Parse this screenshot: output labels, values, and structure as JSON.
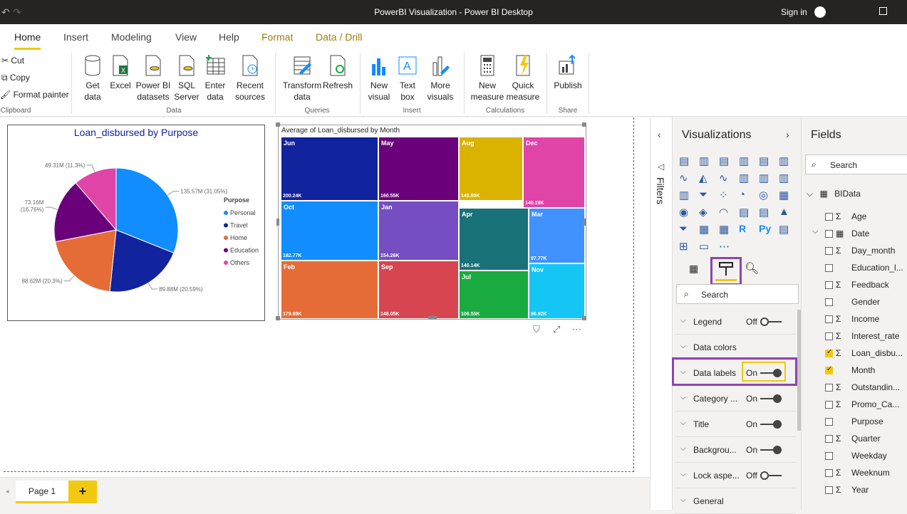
{
  "window": {
    "title": "PowerBI Visualization - Power BI Desktop",
    "signin": "Sign in"
  },
  "tabs": [
    "Home",
    "Insert",
    "Modeling",
    "View",
    "Help",
    "Format",
    "Data / Drill"
  ],
  "ribbon": {
    "clipboard": {
      "cut": "Cut",
      "copy": "Copy",
      "format_painter": "Format painter",
      "group": "Clipboard"
    },
    "data": {
      "get_data": "Get\ndata",
      "excel": "Excel",
      "pbi_datasets": "Power BI\ndatasets",
      "sql": "SQL\nServer",
      "enter": "Enter\ndata",
      "recent": "Recent\nsources",
      "group": "Data"
    },
    "queries": {
      "transform": "Transform\ndata",
      "refresh": "Refresh",
      "group": "Queries"
    },
    "insert": {
      "new_visual": "New\nvisual",
      "text_box": "Text\nbox",
      "more_visuals": "More\nvisuals",
      "group": "Insert"
    },
    "calculations": {
      "new_measure": "New\nmeasure",
      "quick_measure": "Quick\nmeasure",
      "group": "Calculations"
    },
    "share": {
      "publish": "Publish",
      "group": "Share"
    }
  },
  "pie_chart": {
    "title": "Loan_disbursed by Purpose",
    "legend_title": "Purpose",
    "slices": [
      {
        "name": "Personal",
        "label": "135.57M (31.05%)",
        "share": 0.3105,
        "color": "#118DFF"
      },
      {
        "name": "Travel",
        "label": "89.88M (20.59%)",
        "share": 0.2059,
        "color": "#12239E"
      },
      {
        "name": "Home",
        "label": "88.62M (20.3%)",
        "share": 0.203,
        "color": "#E66C37"
      },
      {
        "name": "Education",
        "label": "73.16M (16.76%)",
        "share": 0.1676,
        "color": "#6B007B"
      },
      {
        "name": "Others",
        "label": "49.31M (11.3%)",
        "share": 0.113,
        "color": "#E044A7"
      }
    ]
  },
  "treemap": {
    "title": "Average of Loan_disbursed by Month",
    "tiles": [
      {
        "name": "Jun",
        "value": "200.24K",
        "color": "#12239E"
      },
      {
        "name": "May",
        "value": "160.55K",
        "color": "#6B007B"
      },
      {
        "name": "Aug",
        "value": "145.80K",
        "color": "#D9B300"
      },
      {
        "name": "Dec",
        "value": "140.19K",
        "color": "#E044A7"
      },
      {
        "name": "Oct",
        "value": "182.77K",
        "color": "#118DFF"
      },
      {
        "name": "Jan",
        "value": "154.26K",
        "color": "#744EC2"
      },
      {
        "name": "Apr",
        "value": "140.14K",
        "color": "#197278"
      },
      {
        "name": "Mar",
        "value": "97.77K",
        "color": "#4092FF"
      },
      {
        "name": "Feb",
        "value": "179.89K",
        "color": "#E66C37"
      },
      {
        "name": "Sep",
        "value": "148.05K",
        "color": "#D64550"
      },
      {
        "name": "Jul",
        "value": "106.55K",
        "color": "#1AAB40"
      },
      {
        "name": "Nov",
        "value": "96.92K",
        "color": "#15C6F4"
      }
    ]
  },
  "filters_label": "Filters",
  "visualizations": {
    "title": "Visualizations",
    "search_placeholder": "Search",
    "format_rows": [
      {
        "label": "Legend",
        "state": "Off"
      },
      {
        "label": "Data colors",
        "state": ""
      },
      {
        "label": "Data labels",
        "state": "On"
      },
      {
        "label": "Category ...",
        "state": "On"
      },
      {
        "label": "Title",
        "state": "On"
      },
      {
        "label": "Backgrou...",
        "state": "On"
      },
      {
        "label": "Lock aspe...",
        "state": "Off"
      },
      {
        "label": "General",
        "state": ""
      }
    ]
  },
  "fields": {
    "title": "Fields",
    "search_placeholder": "Search",
    "table": "BIData",
    "items": [
      {
        "name": "Age",
        "sigma": "Σ",
        "checked": false
      },
      {
        "name": "Date",
        "sigma": "",
        "checked": false
      },
      {
        "name": "Day_month",
        "sigma": "Σ",
        "checked": false
      },
      {
        "name": "Education_l...",
        "sigma": "",
        "checked": false
      },
      {
        "name": "Feedback",
        "sigma": "Σ",
        "checked": false
      },
      {
        "name": "Gender",
        "sigma": "",
        "checked": false
      },
      {
        "name": "Income",
        "sigma": "Σ",
        "checked": false
      },
      {
        "name": "Interest_rate",
        "sigma": "Σ",
        "checked": false
      },
      {
        "name": "Loan_disbu...",
        "sigma": "Σ",
        "checked": true
      },
      {
        "name": "Month",
        "sigma": "",
        "checked": true
      },
      {
        "name": "Outstandin...",
        "sigma": "Σ",
        "checked": false
      },
      {
        "name": "Promo_Ca...",
        "sigma": "Σ",
        "checked": false
      },
      {
        "name": "Purpose",
        "sigma": "",
        "checked": false
      },
      {
        "name": "Quarter",
        "sigma": "Σ",
        "checked": false
      },
      {
        "name": "Weekday",
        "sigma": "",
        "checked": false
      },
      {
        "name": "Weeknum",
        "sigma": "Σ",
        "checked": false
      },
      {
        "name": "Year",
        "sigma": "Σ",
        "checked": false
      }
    ]
  },
  "pages": {
    "page1": "Page 1",
    "add": "+"
  }
}
